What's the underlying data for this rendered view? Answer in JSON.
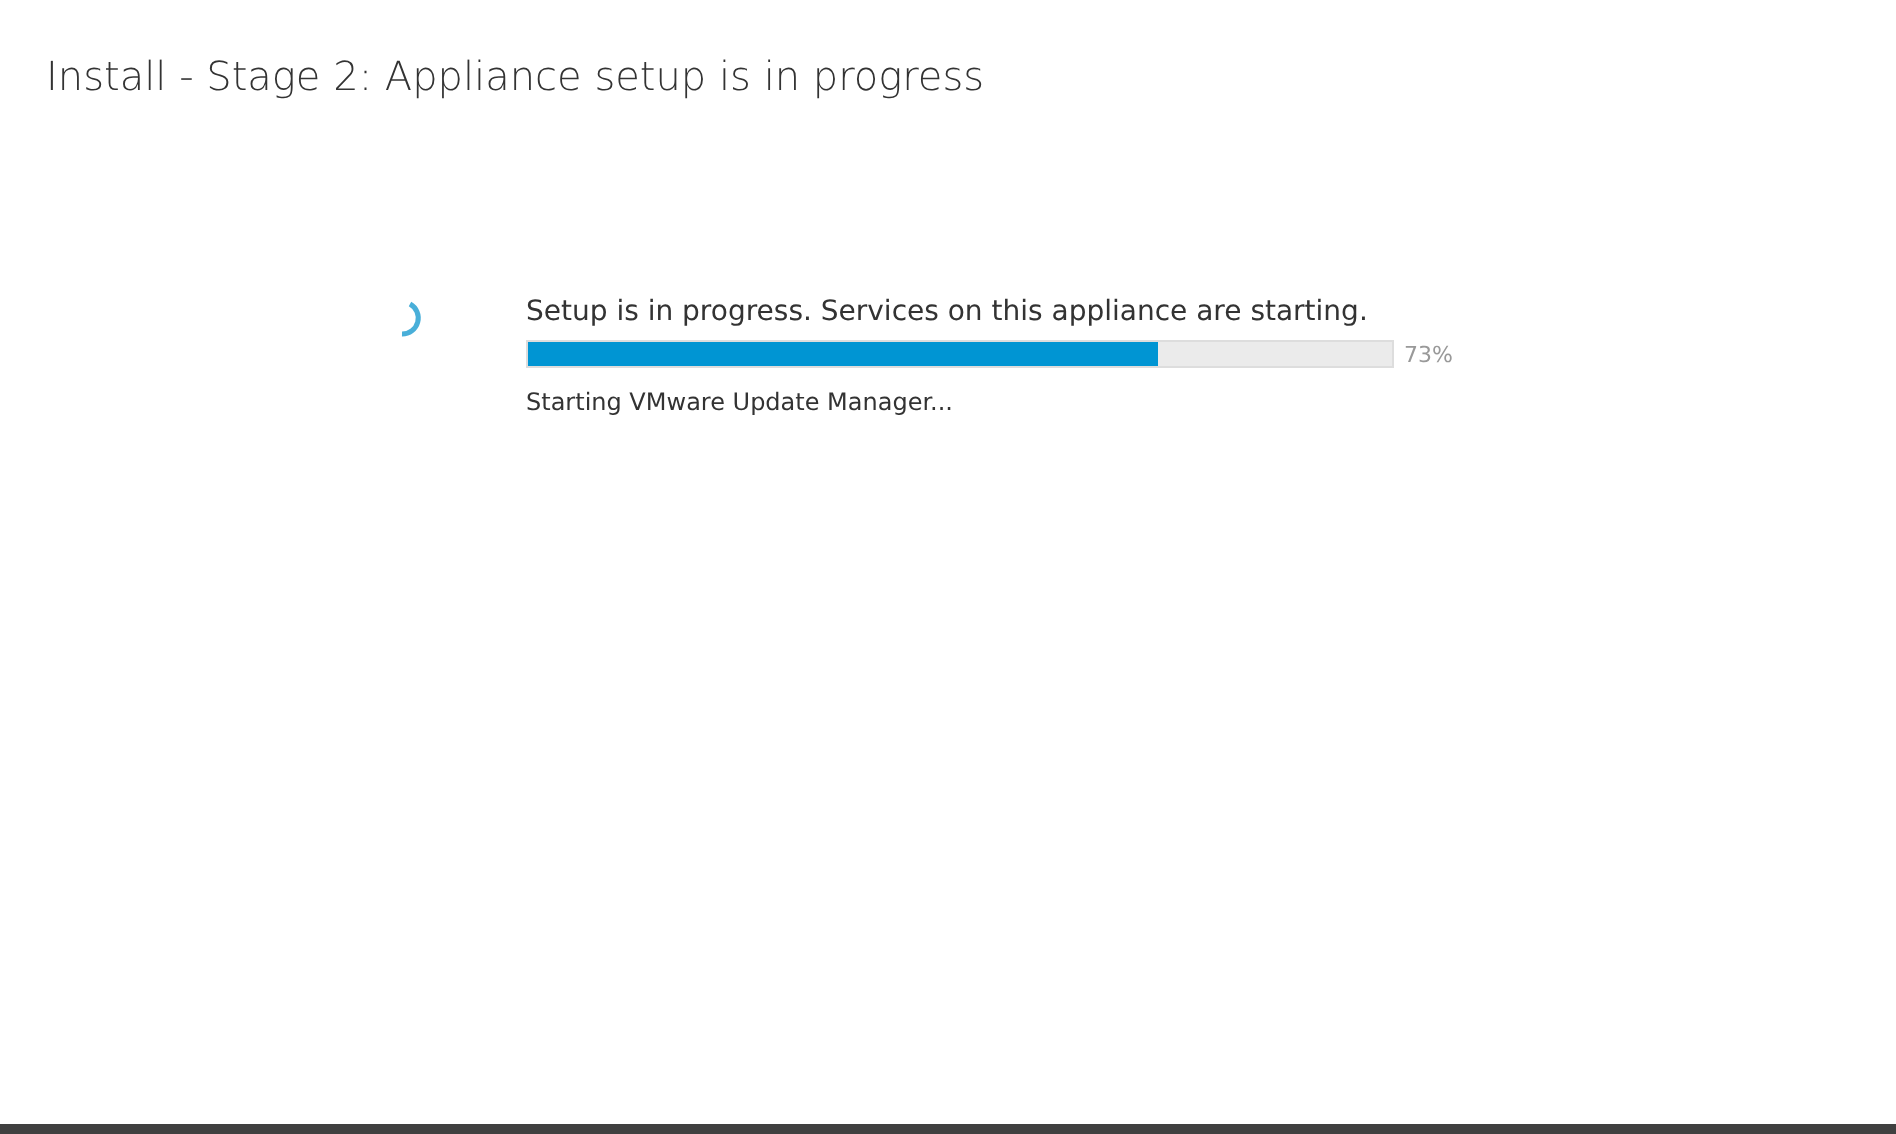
{
  "title": "Install - Stage 2: Appliance setup is in progress",
  "progress": {
    "message": "Setup is in progress. Services on this appliance are starting.",
    "level": 0.73,
    "reading": "73%",
    "status": "Starting VMware Update Manager..."
  }
}
